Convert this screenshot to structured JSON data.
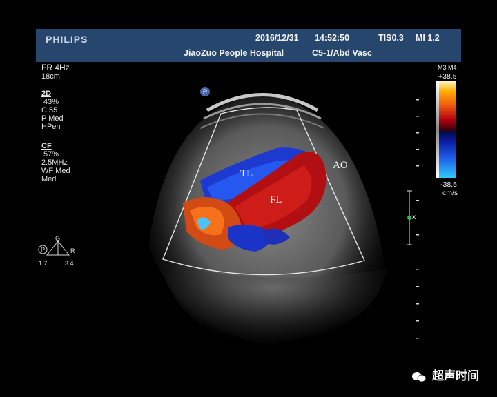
{
  "header": {
    "brand": "PHILIPS",
    "date": "2016/12/31",
    "time": "14:52:50",
    "tis": "TIS0.3",
    "mi": "MI 1.2",
    "hospital": "JiaoZuo People Hospital",
    "probe": "C5-1/Abd Vasc"
  },
  "params": {
    "fr": "FR 4Hz",
    "depth": "18cm",
    "mode2d": "2D",
    "gain2d": "43%",
    "c": "C 55",
    "p": "P Med",
    "hpen": "HPen",
    "cf": "CF",
    "gaincf": "57%",
    "freq": "2.5MHz",
    "wf": "WF Med",
    "med": "Med"
  },
  "colorbar": {
    "mode": "M3 M4",
    "max": "+38.5",
    "min": "-38.5",
    "unit": "cm/s"
  },
  "labels": {
    "tl": "TL",
    "fl": "FL",
    "ao": "AO"
  },
  "gmarker": {
    "g": "G",
    "r": "R",
    "p": "P",
    "left": "1.7",
    "right": "3.4"
  },
  "focus_marker": "x",
  "watermark": "超声时间"
}
